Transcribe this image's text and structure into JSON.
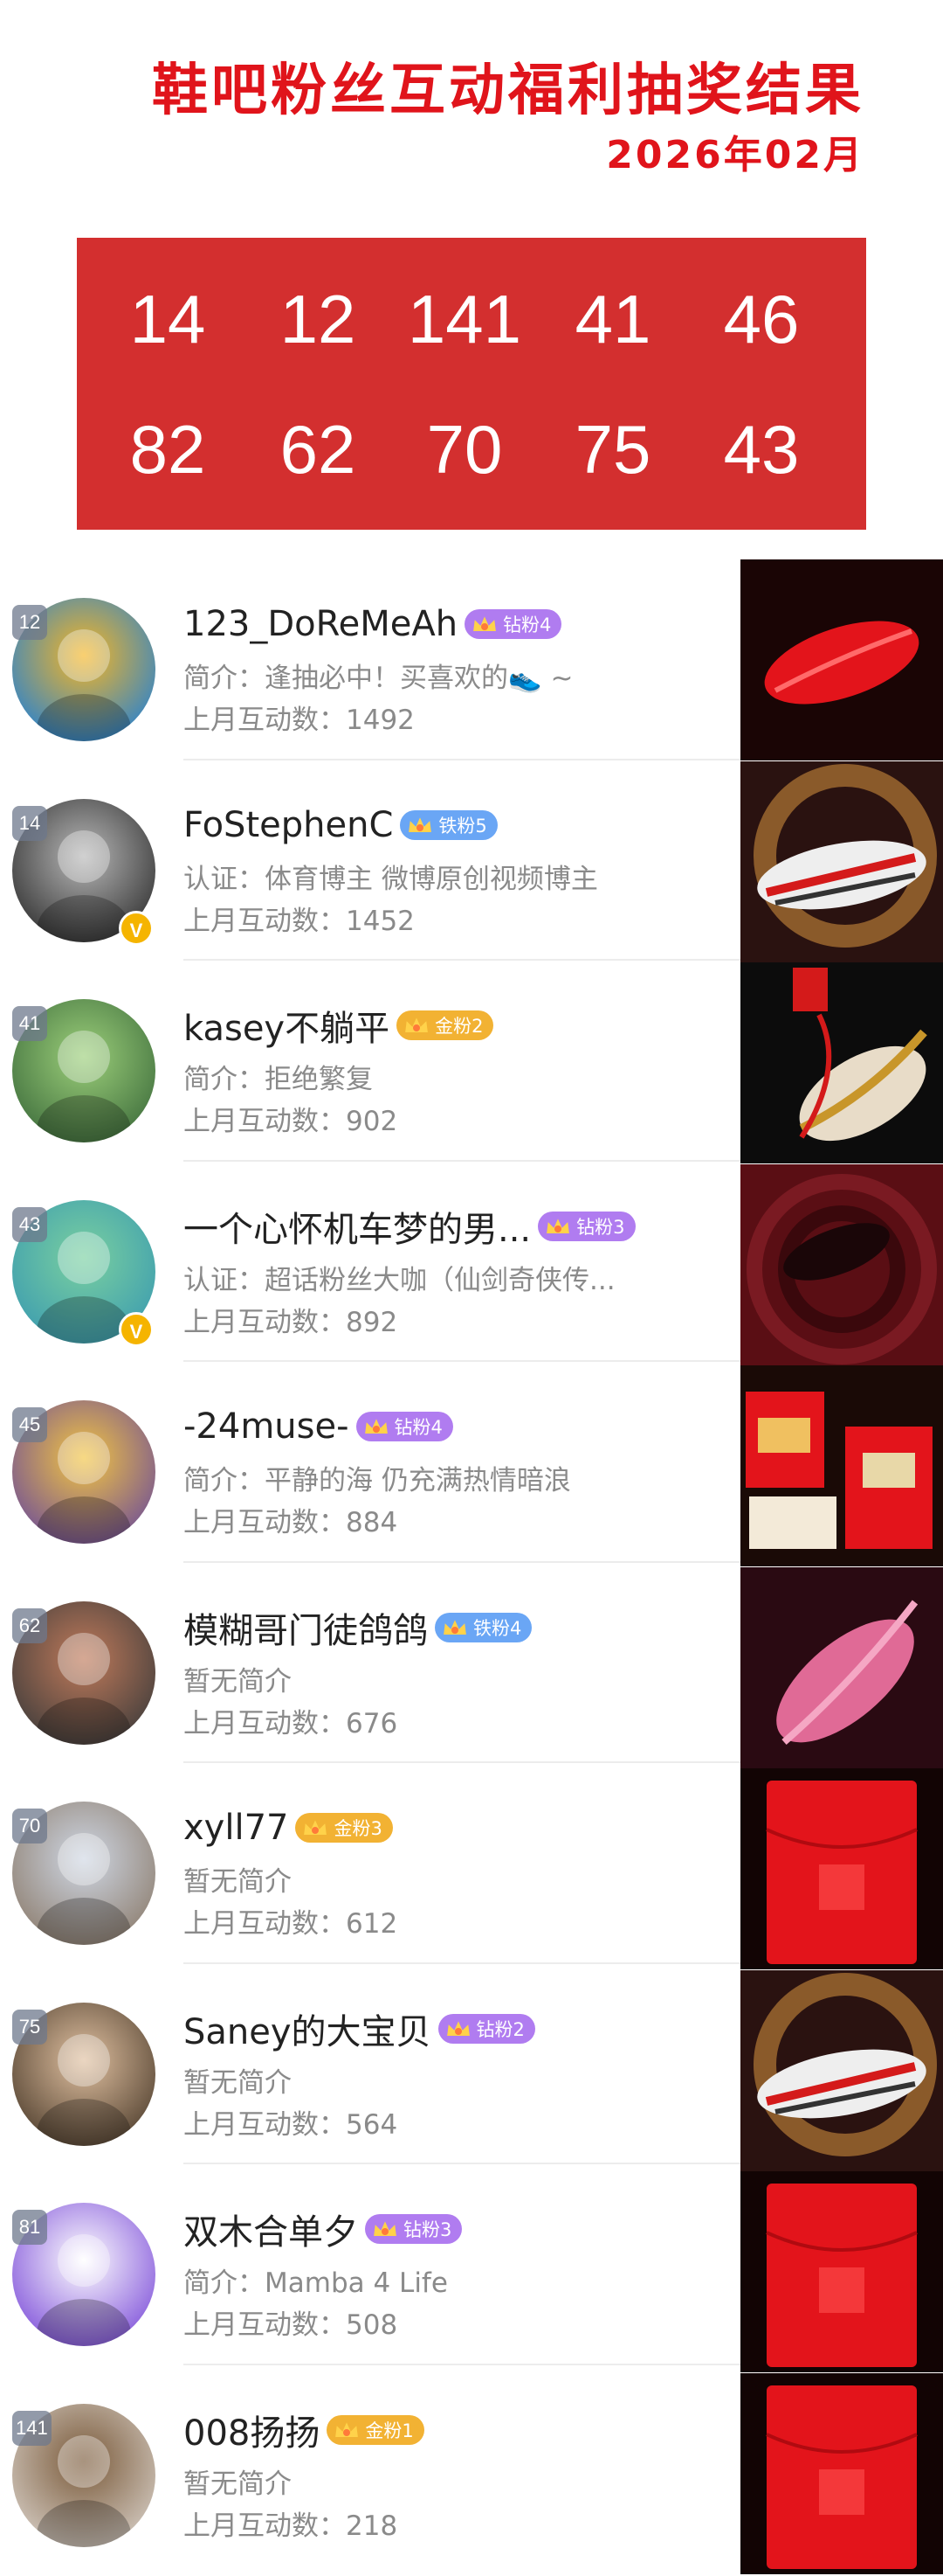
{
  "header": {
    "title": "鞋吧粉丝互动福利抽奖结果",
    "subtitle": "2026年02月"
  },
  "numbers": [
    "14",
    "12",
    "141",
    "41",
    "46",
    "82",
    "62",
    "70",
    "75",
    "43"
  ],
  "colors": {
    "accent": "#e0141b",
    "number_box": "#d32f2f",
    "diamond_badge": "#b07cf0",
    "iron_badge": "#6aa6f5",
    "gold_badge": "#f2b233"
  },
  "winners": [
    {
      "rank": "12",
      "name": "123_DoReMeAh",
      "badge": "钻粉4",
      "badge_type": "diamond",
      "bio": "简介：逢抽必中！买喜欢的👟 ~",
      "count": "上月互动数：1492",
      "verified": false
    },
    {
      "rank": "14",
      "name": "FoStephenC",
      "badge": "铁粉5",
      "badge_type": "iron",
      "bio": "认证：体育博主 微博原创视频博主",
      "count": "上月互动数：1452",
      "verified": true
    },
    {
      "rank": "41",
      "name": "kasey不躺平",
      "badge": "金粉2",
      "badge_type": "gold",
      "bio": "简介：拒绝繁复",
      "count": "上月互动数：902",
      "verified": false
    },
    {
      "rank": "43",
      "name": "一个心怀机车梦的男...",
      "badge": "钻粉3",
      "badge_type": "diamond",
      "bio": "认证：超话粉丝大咖（仙剑奇侠传...",
      "count": "上月互动数：892",
      "verified": true
    },
    {
      "rank": "45",
      "name": "-24muse-",
      "badge": "钻粉4",
      "badge_type": "diamond",
      "bio": "简介：平静的海 仍充满热情暗浪",
      "count": "上月互动数：884",
      "verified": false
    },
    {
      "rank": "62",
      "name": "模糊哥门徒鸽鸽",
      "badge": "铁粉4",
      "badge_type": "iron",
      "bio": "暂无简介",
      "count": "上月互动数：676",
      "verified": false
    },
    {
      "rank": "70",
      "name": "xyll77",
      "badge": "金粉3",
      "badge_type": "gold",
      "bio": "暂无简介",
      "count": "上月互动数：612",
      "verified": false
    },
    {
      "rank": "75",
      "name": "Saney的大宝贝",
      "badge": "钻粉2",
      "badge_type": "diamond",
      "bio": "暂无简介",
      "count": "上月互动数：564",
      "verified": false
    },
    {
      "rank": "81",
      "name": "双木合单夕",
      "badge": "钻粉3",
      "badge_type": "diamond",
      "bio": "简介：Mamba 4 Life",
      "count": "上月互动数：508",
      "verified": false
    },
    {
      "rank": "141",
      "name": "008扬扬",
      "badge": "金粉1",
      "badge_type": "gold",
      "bio": "暂无简介",
      "count": "上月互动数：218",
      "verified": false
    }
  ],
  "products": [
    {
      "icon": "red-sneaker-icon"
    },
    {
      "icon": "white-red-sneaker-icon"
    },
    {
      "icon": "red-gold-sneaker-icon"
    },
    {
      "icon": "dark-swirl-sneaker-icon"
    },
    {
      "icon": "gift-box-icon"
    },
    {
      "icon": "pink-sneaker-icon"
    },
    {
      "icon": "red-envelope-icon"
    },
    {
      "icon": "white-red-sneaker-icon"
    },
    {
      "icon": "red-envelope-icon"
    },
    {
      "icon": "red-envelope-icon"
    }
  ]
}
